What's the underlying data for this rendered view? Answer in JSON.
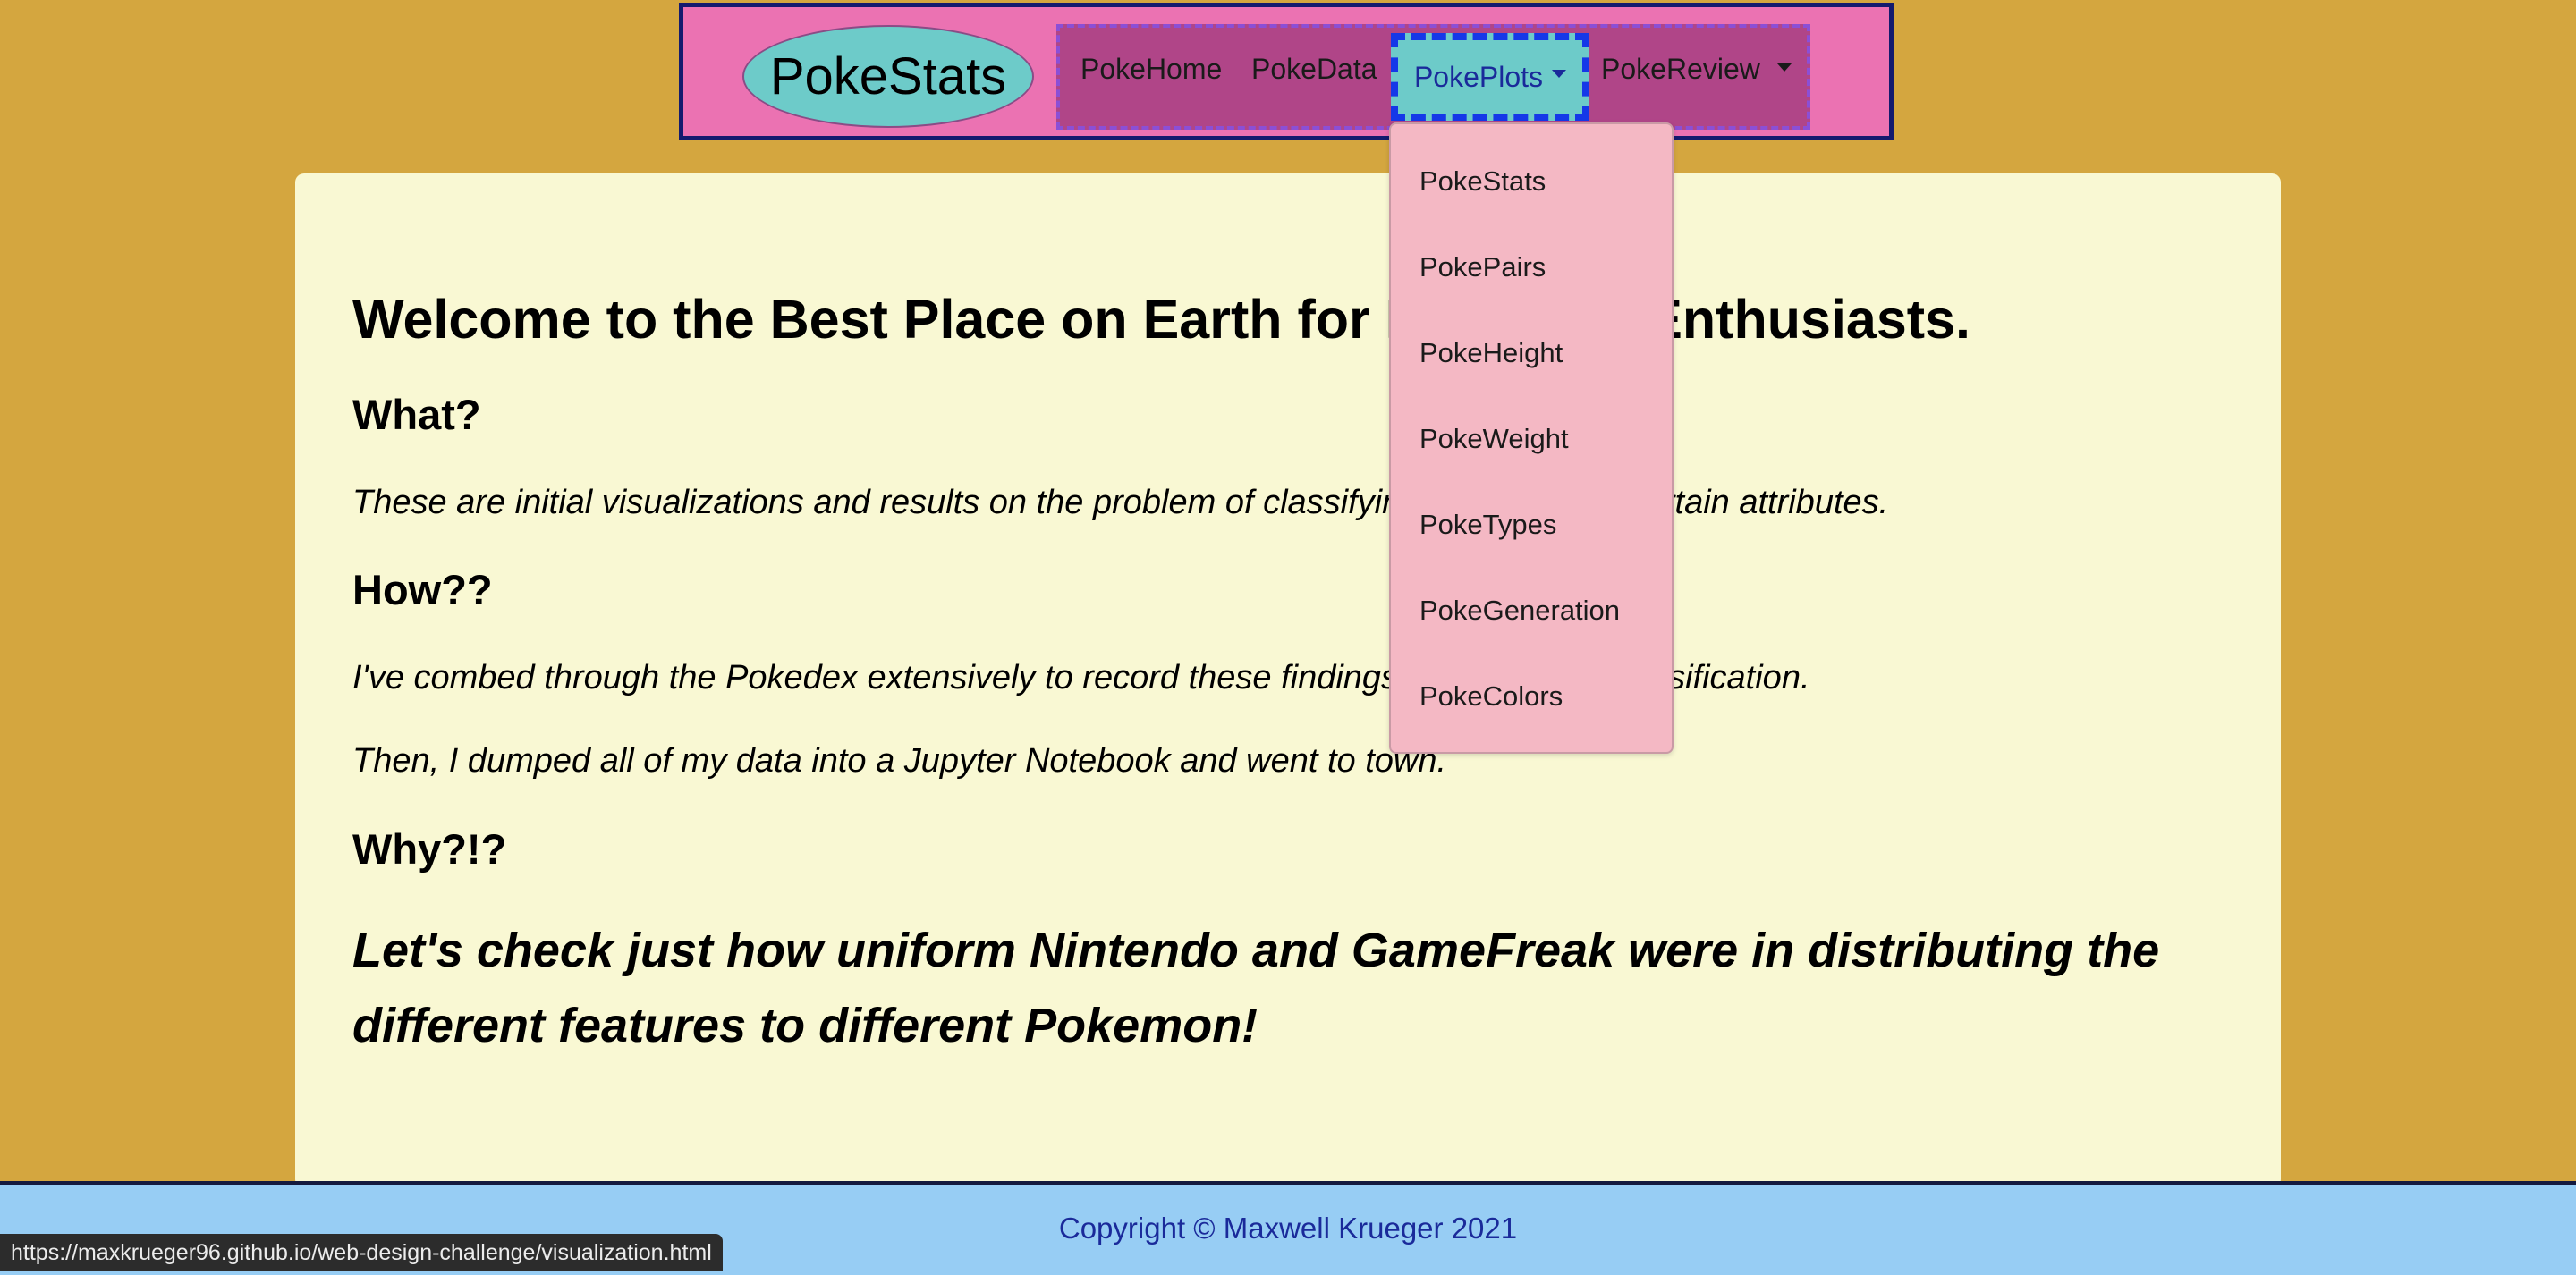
{
  "navbar": {
    "brand": "PokeStats",
    "links": {
      "home": "PokeHome",
      "data": "PokeData",
      "plots": "PokePlots",
      "review": "PokeReview"
    },
    "active_link": "PokePlots"
  },
  "dropdown": {
    "items": [
      "PokeStats",
      "PokePairs",
      "PokeHeight",
      "PokeWeight",
      "PokeTypes",
      "PokeGeneration",
      "PokeColors"
    ]
  },
  "content": {
    "headline": "Welcome to the Best Place on Earth for Pokemon Enthusiasts.",
    "sections": [
      {
        "heading": "What?",
        "paragraphs": [
          "These are initial visualizations and results on the problem of classifying Pokemon by certain attributes."
        ]
      },
      {
        "heading": "How??",
        "paragraphs": [
          "I've combed through the Pokedex extensively to record these findings on Pokemon classification.",
          "Then, I dumped all of my data into a Jupyter Notebook and went to town."
        ]
      },
      {
        "heading": "Why?!?",
        "closing": "Let's check just how uniform Nintendo and GameFreak were in distributing the different features to different Pokemon!"
      }
    ]
  },
  "footer": {
    "copyright": "Copyright © Maxwell Krueger 2021"
  },
  "status_bar": {
    "url": "https://maxkrueger96.github.io/web-design-challenge/visualization.html"
  },
  "colors": {
    "page_background": "#d4a63f",
    "navbar_background": "#eb72b2",
    "navbar_border": "#141a6e",
    "brand_background": "#6dcbc9",
    "nav_group_background": "#b04588",
    "active_border": "#1538e8",
    "dropdown_background": "#f4b8c4",
    "card_background": "#f9f8d3",
    "footer_background": "#97cdf4",
    "footer_text": "#1a2a9a"
  }
}
